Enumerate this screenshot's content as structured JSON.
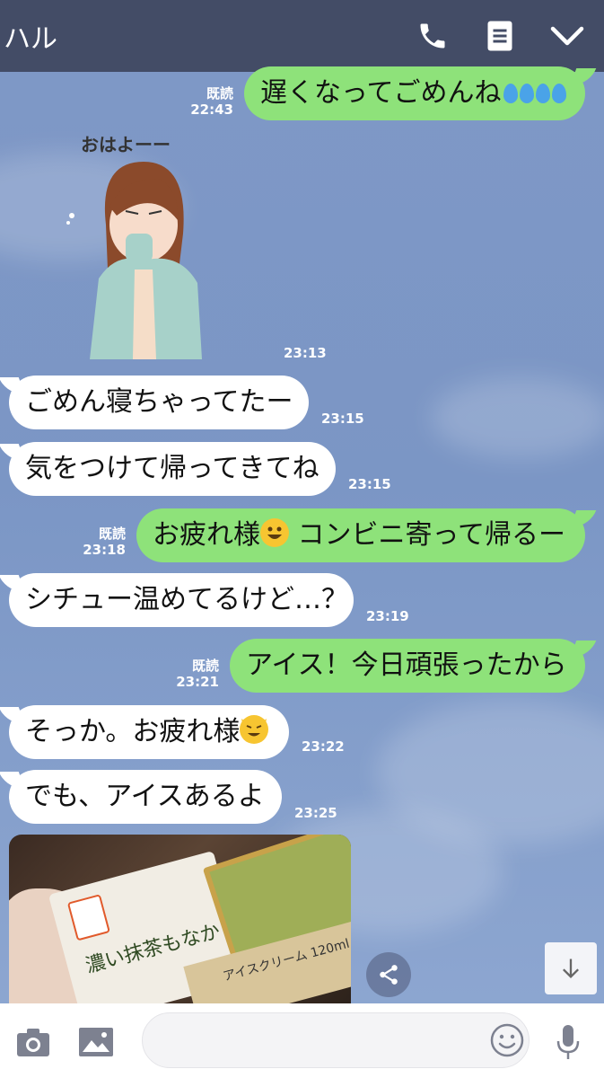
{
  "header": {
    "title": "ハル",
    "icons": [
      "phone-icon",
      "notes-icon",
      "chevron-down-icon"
    ]
  },
  "messages": [
    {
      "side": "out",
      "text": "遅くなってごめんね",
      "emoji": "sweat-drops",
      "read": "既読",
      "time": "22:43"
    },
    {
      "side": "in",
      "type": "sticker",
      "sticker_text": "おはよーー",
      "time": "23:13"
    },
    {
      "side": "in",
      "text": "ごめん寝ちゃってたー",
      "time": "23:15"
    },
    {
      "side": "in",
      "text": "気をつけて帰ってきてね",
      "time": "23:15"
    },
    {
      "side": "out",
      "text_before": "お疲れ様",
      "emoji": "grinning-face",
      "text_after": " コンビニ寄って帰るー",
      "read": "既読",
      "time": "23:18"
    },
    {
      "side": "in",
      "text": "シチュー温めてるけど…？",
      "time": "23:19"
    },
    {
      "side": "out",
      "text": "アイス！今日頑張ったから",
      "read": "既読",
      "time": "23:21"
    },
    {
      "side": "in",
      "text": "そっか。お疲れ様",
      "emoji": "cat-face",
      "time": "23:22"
    },
    {
      "side": "in",
      "text": "でも、アイスあるよ",
      "time": "23:25"
    },
    {
      "side": "in",
      "type": "photo",
      "photo_caption": "濃い抹茶もなか",
      "photo_label": "アイスクリーム 120ml"
    }
  ],
  "footer": {
    "input_placeholder": "",
    "icons": [
      "camera-icon",
      "image-icon",
      "emoji-icon",
      "microphone-icon"
    ]
  },
  "colors": {
    "header": "#434c66",
    "outgoing": "#8ee27a",
    "incoming": "#ffffff",
    "background": "#7d97c4"
  }
}
